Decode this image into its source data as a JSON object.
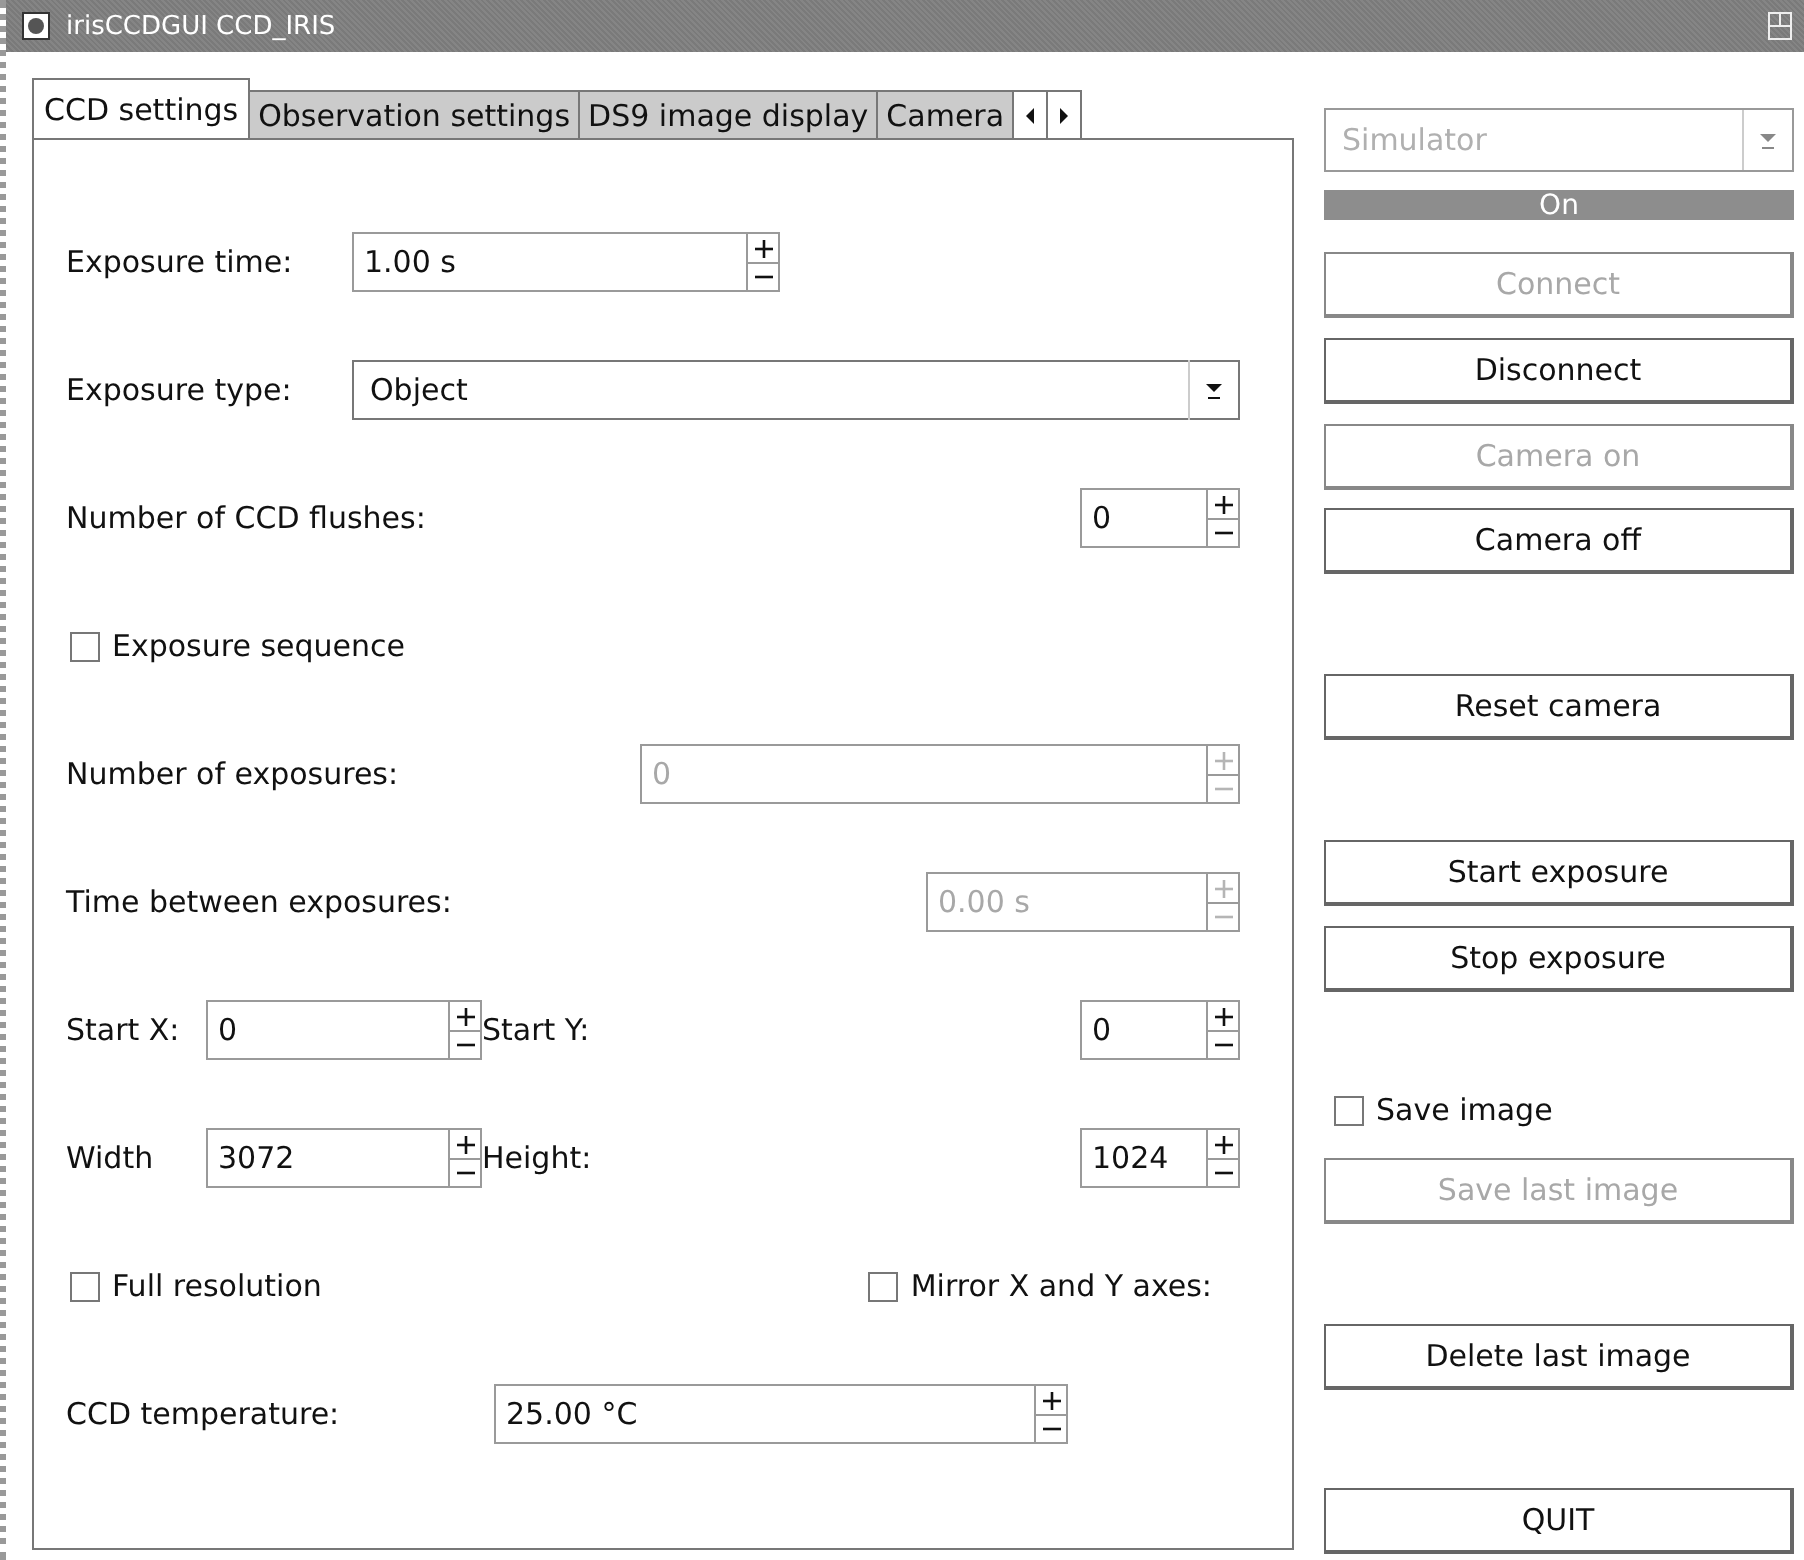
{
  "window": {
    "title": "irisCCDGUI CCD_IRIS"
  },
  "tabs": [
    {
      "label": "CCD settings",
      "selected": true
    },
    {
      "label": "Observation settings",
      "selected": false
    },
    {
      "label": "DS9 image display",
      "selected": false
    },
    {
      "label": "Camera",
      "selected": false
    }
  ],
  "settings": [
    {
      "kind": "spin",
      "label": "Exposure time:",
      "value": "1.00 s",
      "disabled": false
    },
    {
      "kind": "combo",
      "label": "Exposure type:",
      "value": "Object"
    },
    {
      "kind": "spin",
      "label": "Number of CCD flushes:",
      "value": "0",
      "disabled": false
    },
    {
      "kind": "checkbox",
      "label": "Exposure sequence",
      "checked": false
    },
    {
      "kind": "spin",
      "label": "Number of exposures:",
      "value": "0",
      "disabled": true
    },
    {
      "kind": "spin",
      "label": "Time between exposures:",
      "value": "0.00 s",
      "disabled": true
    },
    {
      "kind": "spinpair",
      "fields": [
        {
          "label": "Start X:",
          "value": "0"
        },
        {
          "label": "Start Y:",
          "value": "0"
        }
      ]
    },
    {
      "kind": "spinpair",
      "fields": [
        {
          "label": "Width",
          "value": "3072"
        },
        {
          "label": "Height:",
          "value": "1024"
        }
      ]
    },
    {
      "kind": "checkpair",
      "fields": [
        {
          "label": "Full resolution",
          "checked": false
        },
        {
          "label": "Mirror X and Y axes:",
          "checked": false
        }
      ]
    },
    {
      "kind": "spin",
      "label": "CCD temperature:",
      "value": "25.00 °C",
      "disabled": false
    }
  ],
  "side_panel": [
    {
      "kind": "combo",
      "value": "Simulator",
      "disabled": true
    },
    {
      "kind": "status",
      "label": "On"
    },
    {
      "kind": "button",
      "label": "Connect",
      "disabled": true
    },
    {
      "kind": "button",
      "label": "Disconnect",
      "disabled": false
    },
    {
      "kind": "button",
      "label": "Camera on",
      "disabled": true
    },
    {
      "kind": "button",
      "label": "Camera off",
      "disabled": false
    },
    {
      "kind": "button",
      "label": "Reset camera",
      "disabled": false
    },
    {
      "kind": "button",
      "label": "Start exposure",
      "disabled": false
    },
    {
      "kind": "button",
      "label": "Stop exposure",
      "disabled": false
    },
    {
      "kind": "checkbox",
      "label": "Save image",
      "checked": false
    },
    {
      "kind": "button",
      "label": "Save last image",
      "disabled": true
    },
    {
      "kind": "button",
      "label": "Delete last image",
      "disabled": false
    },
    {
      "kind": "button",
      "label": "QUIT",
      "disabled": false
    }
  ]
}
